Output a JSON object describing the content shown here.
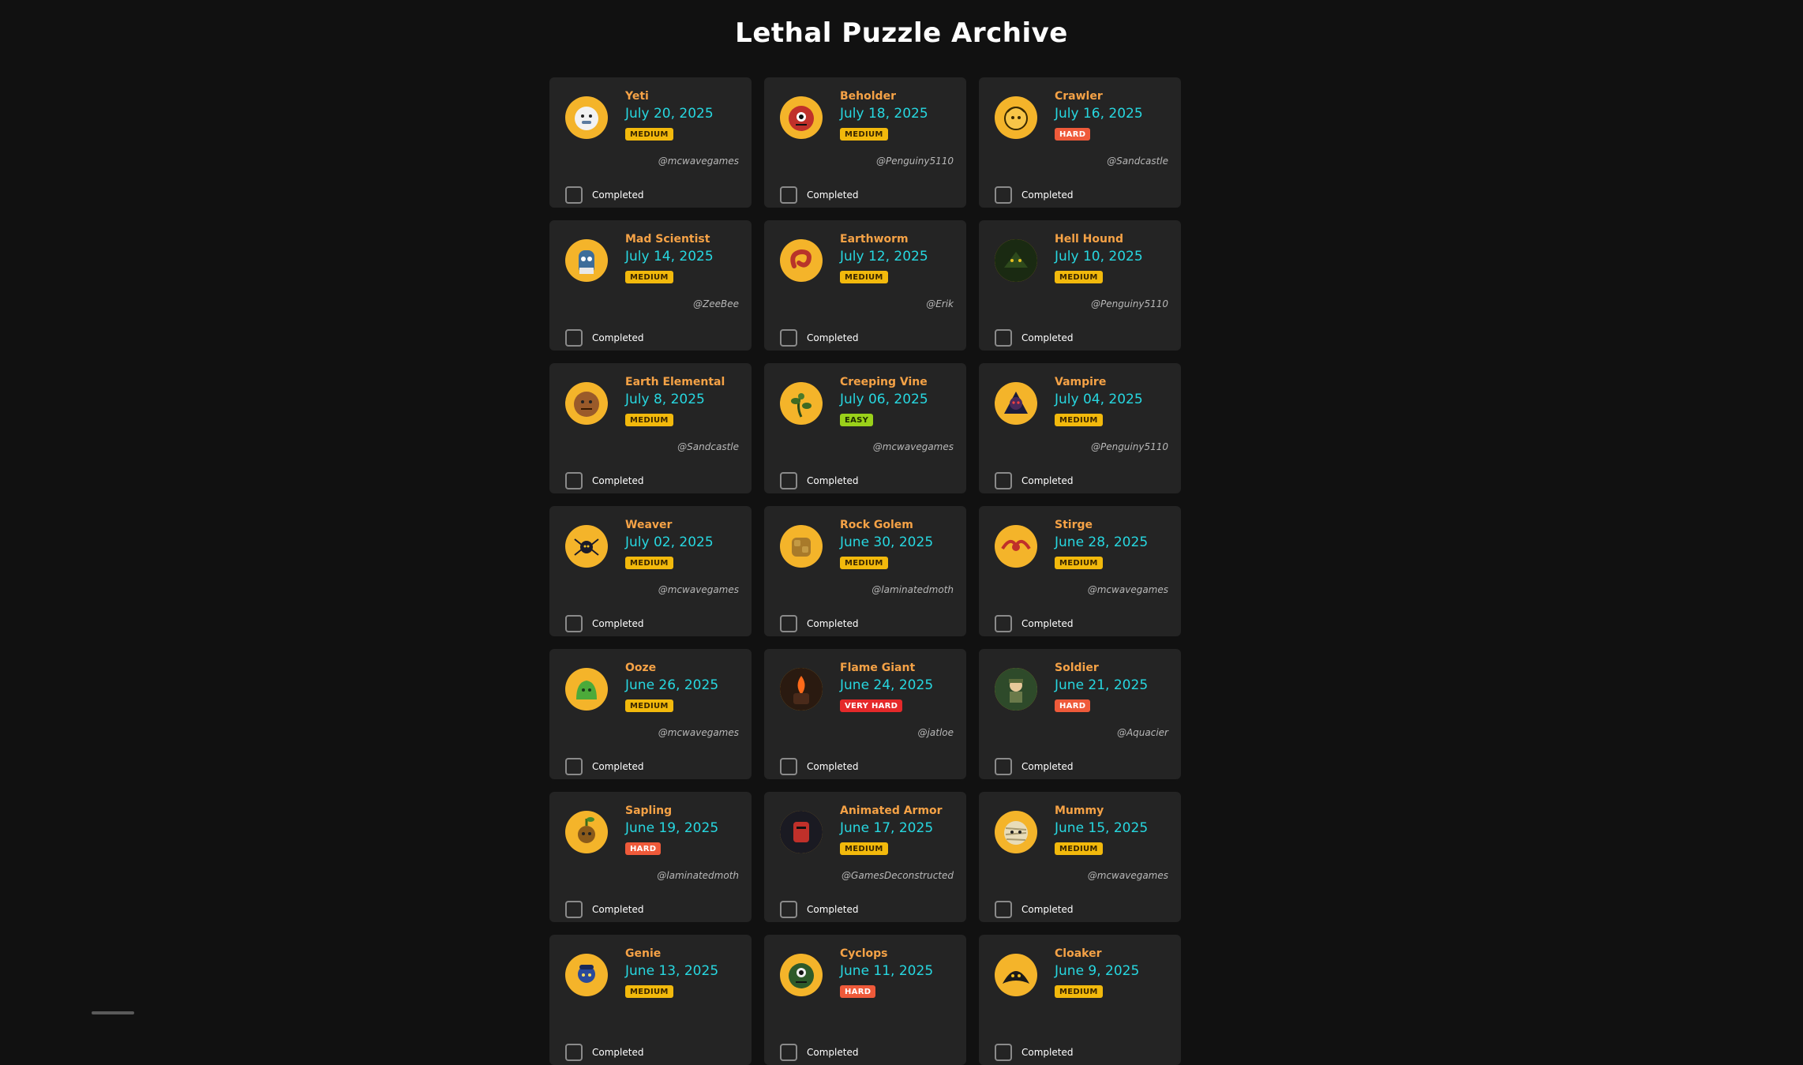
{
  "page": {
    "title": "Lethal Puzzle Archive"
  },
  "colors": {
    "background": "#111111",
    "card": "#242424",
    "name": "#f5a246",
    "date": "#27d7e0",
    "avatar": "#f4b42a",
    "medium": "#f2b90c",
    "hard": "#ef5a3a",
    "easy": "#9ad11a",
    "very_hard": "#e5292a"
  },
  "completed_label": "Completed",
  "puzzles": [
    {
      "name": "Yeti",
      "date": "July 20, 2025",
      "difficulty": "MEDIUM",
      "author": "@mcwavegames",
      "completed": false,
      "icon": "yeti-icon"
    },
    {
      "name": "Beholder",
      "date": "July 18, 2025",
      "difficulty": "MEDIUM",
      "author": "@Penguiny5110",
      "completed": false,
      "icon": "beholder-icon"
    },
    {
      "name": "Crawler",
      "date": "July 16, 2025",
      "difficulty": "HARD",
      "author": "@Sandcastle",
      "completed": false,
      "icon": "crawler-icon"
    },
    {
      "name": "Mad Scientist",
      "date": "July 14, 2025",
      "difficulty": "MEDIUM",
      "author": "@ZeeBee",
      "completed": false,
      "icon": "mad-scientist-icon"
    },
    {
      "name": "Earthworm",
      "date": "July 12, 2025",
      "difficulty": "MEDIUM",
      "author": "@Erik",
      "completed": false,
      "icon": "earthworm-icon"
    },
    {
      "name": "Hell Hound",
      "date": "July 10, 2025",
      "difficulty": "MEDIUM",
      "author": "@Penguiny5110",
      "completed": false,
      "icon": "hell-hound-icon"
    },
    {
      "name": "Earth Elemental",
      "date": "July 8, 2025",
      "difficulty": "MEDIUM",
      "author": "@Sandcastle",
      "completed": false,
      "icon": "earth-elemental-icon"
    },
    {
      "name": "Creeping Vine",
      "date": "July 06, 2025",
      "difficulty": "EASY",
      "author": "@mcwavegames",
      "completed": false,
      "icon": "creeping-vine-icon"
    },
    {
      "name": "Vampire",
      "date": "July 04, 2025",
      "difficulty": "MEDIUM",
      "author": "@Penguiny5110",
      "completed": false,
      "icon": "vampire-icon"
    },
    {
      "name": "Weaver",
      "date": "July 02, 2025",
      "difficulty": "MEDIUM",
      "author": "@mcwavegames",
      "completed": false,
      "icon": "weaver-icon"
    },
    {
      "name": "Rock Golem",
      "date": "June 30, 2025",
      "difficulty": "MEDIUM",
      "author": "@laminatedmoth",
      "completed": false,
      "icon": "rock-golem-icon"
    },
    {
      "name": "Stirge",
      "date": "June 28, 2025",
      "difficulty": "MEDIUM",
      "author": "@mcwavegames",
      "completed": false,
      "icon": "stirge-icon"
    },
    {
      "name": "Ooze",
      "date": "June 26, 2025",
      "difficulty": "MEDIUM",
      "author": "@mcwavegames",
      "completed": false,
      "icon": "ooze-icon"
    },
    {
      "name": "Flame Giant",
      "date": "June 24, 2025",
      "difficulty": "VERY HARD",
      "author": "@jatloe",
      "completed": false,
      "icon": "flame-giant-icon"
    },
    {
      "name": "Soldier",
      "date": "June 21, 2025",
      "difficulty": "HARD",
      "author": "@Aquacier",
      "completed": false,
      "icon": "soldier-icon"
    },
    {
      "name": "Sapling",
      "date": "June 19, 2025",
      "difficulty": "HARD",
      "author": "@laminatedmoth",
      "completed": false,
      "icon": "sapling-icon"
    },
    {
      "name": "Animated Armor",
      "date": "June 17, 2025",
      "difficulty": "MEDIUM",
      "author": "@GamesDeconstructed",
      "completed": false,
      "icon": "animated-armor-icon"
    },
    {
      "name": "Mummy",
      "date": "June 15, 2025",
      "difficulty": "MEDIUM",
      "author": "@mcwavegames",
      "completed": false,
      "icon": "mummy-icon"
    },
    {
      "name": "Genie",
      "date": "June 13, 2025",
      "difficulty": "MEDIUM",
      "author": "",
      "completed": false,
      "icon": "genie-icon"
    },
    {
      "name": "Cyclops",
      "date": "June 11, 2025",
      "difficulty": "HARD",
      "author": "",
      "completed": false,
      "icon": "cyclops-icon"
    },
    {
      "name": "Cloaker",
      "date": "June 9, 2025",
      "difficulty": "MEDIUM",
      "author": "",
      "completed": false,
      "icon": "cloaker-icon"
    }
  ]
}
